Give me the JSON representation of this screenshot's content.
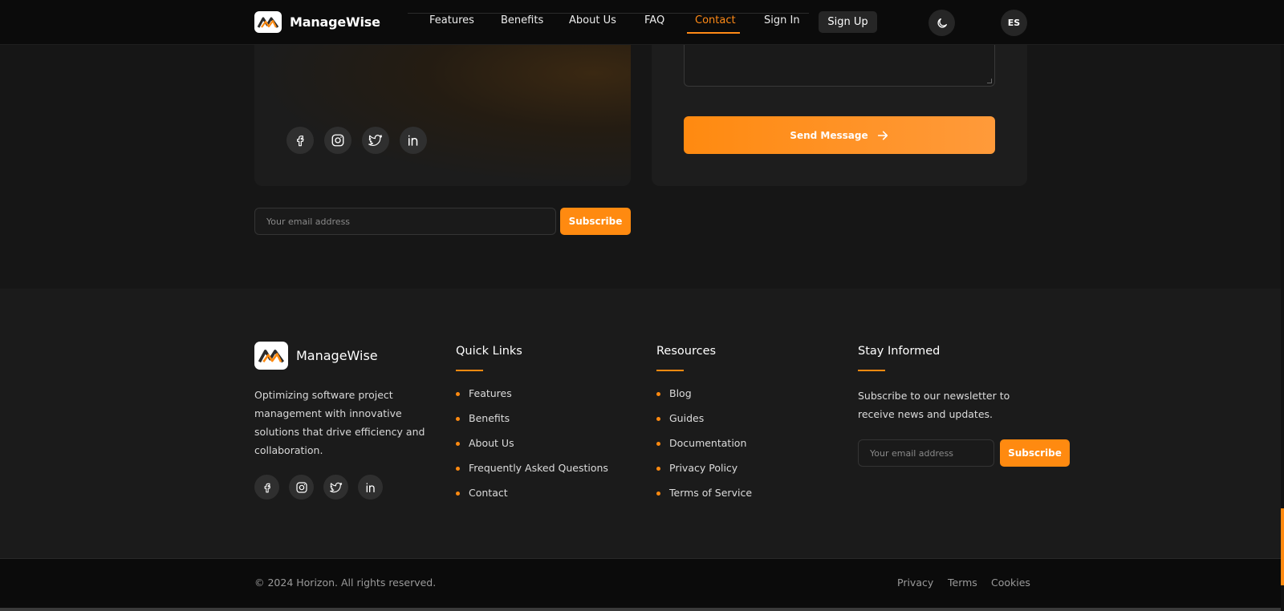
{
  "brand": {
    "name": "ManageWise"
  },
  "nav": {
    "links": [
      "Features",
      "Benefits",
      "About Us",
      "FAQ",
      "Contact",
      "Sign In"
    ],
    "active": "Contact",
    "signup": "Sign Up",
    "theme_icon": "moon-icon",
    "language": "ES"
  },
  "contact": {
    "send_label": "Send Message",
    "send_icon": "arrow-right-icon"
  },
  "social_icons": [
    "facebook-icon",
    "instagram-icon",
    "twitter-icon",
    "linkedin-icon"
  ],
  "newsletter_top": {
    "placeholder": "Your email address",
    "button": "Subscribe"
  },
  "footer": {
    "description": "Optimizing software project management with innovative solutions that drive efficiency and collaboration.",
    "quick_links": {
      "title": "Quick Links",
      "items": [
        "Features",
        "Benefits",
        "About Us",
        "Frequently Asked Questions",
        "Contact"
      ]
    },
    "resources": {
      "title": "Resources",
      "items": [
        "Blog",
        "Guides",
        "Documentation",
        "Privacy Policy",
        "Terms of Service"
      ]
    },
    "stay_informed": {
      "title": "Stay Informed",
      "description": "Subscribe to our newsletter to receive news and updates.",
      "placeholder": "Your email address",
      "button": "Subscribe"
    }
  },
  "bottom_bar": {
    "copyright": "© 2024 Horizon. All rights reserved.",
    "links": [
      "Privacy",
      "Terms",
      "Cookies"
    ]
  },
  "colors": {
    "accent": "#ff8a10",
    "background": "#161616",
    "footer": "#1b1b1b",
    "nav": "#0b0b0b"
  }
}
